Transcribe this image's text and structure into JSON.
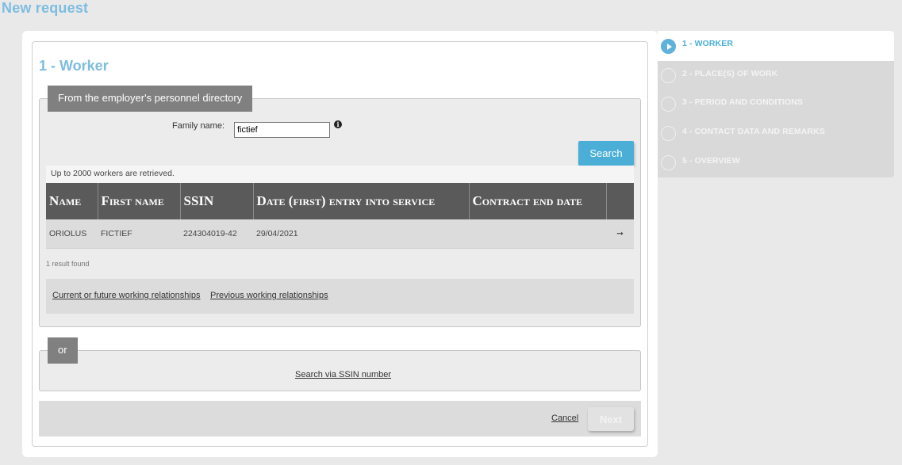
{
  "page": {
    "title": "New request"
  },
  "section": {
    "title": "1 - Worker"
  },
  "directory": {
    "legend": "From the employer's personnel directory",
    "family_name_label": "Family name:",
    "family_name_value": "fictief",
    "search_label": "Search",
    "note": "Up to 2000 workers are retrieved.",
    "columns": [
      "Name",
      "First name",
      "SSIN",
      "Date (first) entry into service",
      "Contract end date"
    ],
    "rows": [
      {
        "name": "ORIOLUS",
        "first_name": "FICTIEF",
        "ssin": "224304019-42",
        "entry_date": "29/04/2021",
        "end_date": "",
        "action": "➞"
      }
    ],
    "result_count": "1 result found",
    "links": {
      "current": "Current or future working relationships",
      "previous": "Previous working relationships"
    }
  },
  "alternative": {
    "legend": "or",
    "ssin_link": "Search via SSIN number"
  },
  "footer": {
    "cancel_label": "Cancel",
    "next_label": "Next"
  },
  "steps": [
    {
      "label": "1 - WORKER",
      "active": true
    },
    {
      "label": "2 - PLACE(S) OF WORK",
      "active": false
    },
    {
      "label": "3 - PERIOD AND CONDITIONS",
      "active": false
    },
    {
      "label": "4 - CONTACT DATA AND REMARKS",
      "active": false
    },
    {
      "label": "5 - OVERVIEW",
      "active": false
    }
  ],
  "colors": {
    "accent": "#4aaed6",
    "title": "#7dbde0",
    "legend_bg": "#808080",
    "header_bg": "#5a5a5a"
  }
}
